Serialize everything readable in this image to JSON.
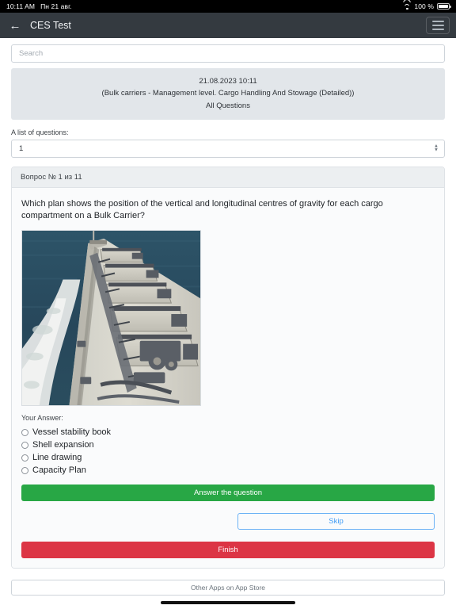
{
  "status_bar": {
    "time": "10:11 AM",
    "date": "Пн 21 авг.",
    "wifi_icon": "wifi-icon",
    "battery_percent": "100 %",
    "battery_icon": "battery-icon"
  },
  "navbar": {
    "back_icon": "back-arrow-icon",
    "title": "CES Test",
    "menu_icon": "hamburger-menu-icon"
  },
  "search": {
    "value": "",
    "placeholder": "Search"
  },
  "info_panel": {
    "datetime": "21.08.2023 10:11",
    "course": "(Bulk carriers - Management level. Cargo Handling And Stowage (Detailed))",
    "scope": "All Questions"
  },
  "question_list": {
    "label": "A list of questions:",
    "selected": "1",
    "options": [
      "1"
    ],
    "stepper_icon": "chevron-up-down-icon"
  },
  "question": {
    "header": "Вопрос № 1 из 11",
    "text": "Which plan shows the position of the vertical and longitudinal centres of gravity for each cargo compartment on a Bulk Carrier?",
    "image_alt": "bulk-carrier-deck-photo",
    "answer_label": "Your Answer:",
    "options": [
      {
        "label": "Vessel stability book",
        "selected": false
      },
      {
        "label": "Shell expansion",
        "selected": false
      },
      {
        "label": "Line drawing",
        "selected": false
      },
      {
        "label": "Capacity Plan",
        "selected": false
      }
    ]
  },
  "actions": {
    "answer_label": "Answer the question",
    "skip_label": "Skip",
    "finish_label": "Finish"
  },
  "footer": {
    "appstore_label": "Other Apps on App Store"
  },
  "colors": {
    "navbar": "#343a40",
    "success": "#28a745",
    "danger": "#dc3545",
    "link": "#3f9bf5",
    "panel": "#e2e6ea"
  }
}
